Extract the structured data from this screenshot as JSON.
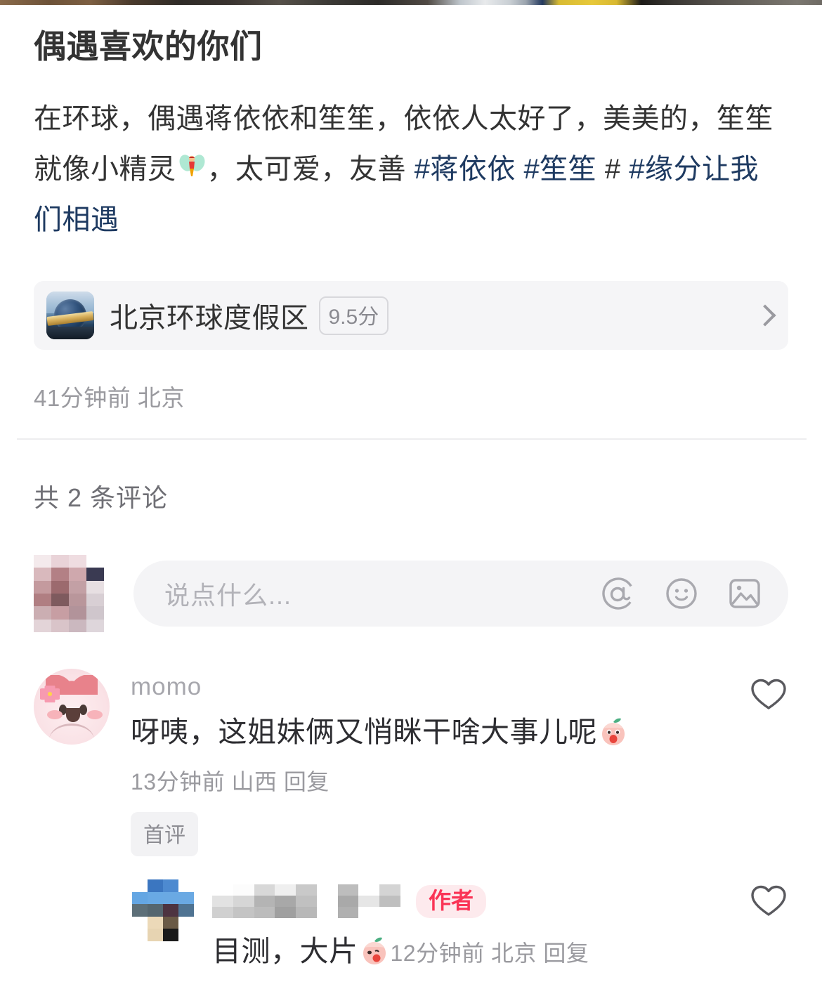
{
  "note": {
    "title": "偶遇喜欢的你们",
    "body_segments": [
      {
        "type": "text",
        "value": "在环球，偶遇蒋依依和笙笙，依依人太好了，美美的，笙笙就像小精灵"
      },
      {
        "type": "emoji",
        "value": "🧚",
        "name": "fairy-emoji"
      },
      {
        "type": "text",
        "value": "，太可爱，友善 "
      },
      {
        "type": "tag",
        "value": "#蒋依依"
      },
      {
        "type": "text",
        "value": "  "
      },
      {
        "type": "tag",
        "value": "#笙笙"
      },
      {
        "type": "hash_plain",
        "value": " # "
      },
      {
        "type": "tag",
        "value": "#缘分让我们相遇"
      }
    ],
    "meta": "41分钟前 北京"
  },
  "poi": {
    "name": "北京环球度假区",
    "score": "9.5分",
    "thumb_alt": "universal-beijing-globe",
    "arrow": "chevron-right-icon"
  },
  "comments_section": {
    "count_label": "共 2 条评论"
  },
  "composer": {
    "placeholder": "说点什么...",
    "value": "",
    "icons": [
      {
        "name": "mention-icon",
        "glyph": "@"
      },
      {
        "name": "emoji-icon",
        "glyph": "☺"
      },
      {
        "name": "image-icon",
        "glyph": "🖼"
      }
    ]
  },
  "comments": [
    {
      "id": "c1",
      "username": "momo",
      "avatar_alt": "momo-cartoon-avatar",
      "text": "呀咦，这姐妹俩又悄眯干啥大事儿呢",
      "text_emoji": "🍑",
      "meta": "13分钟前 山西 回复",
      "badge": "首评",
      "like_icon": "heart-outline-icon"
    }
  ],
  "reply": {
    "id": "r1",
    "username_masked": "",
    "avatar_alt": "blurred-avatar",
    "author_badge": "作者",
    "text": "目测，大片",
    "text_emoji": "🍑",
    "meta": "12分钟前 北京 回复",
    "like_icon": "heart-outline-icon"
  },
  "colors": {
    "tag_link": "#1e3a61",
    "author_badge_bg": "#fdeaed",
    "author_badge_text": "#fa3456",
    "muted_text": "#9a9a9f",
    "body_text": "#333333",
    "field_bg": "#f4f4f6",
    "card_bg": "#f5f5f7"
  }
}
